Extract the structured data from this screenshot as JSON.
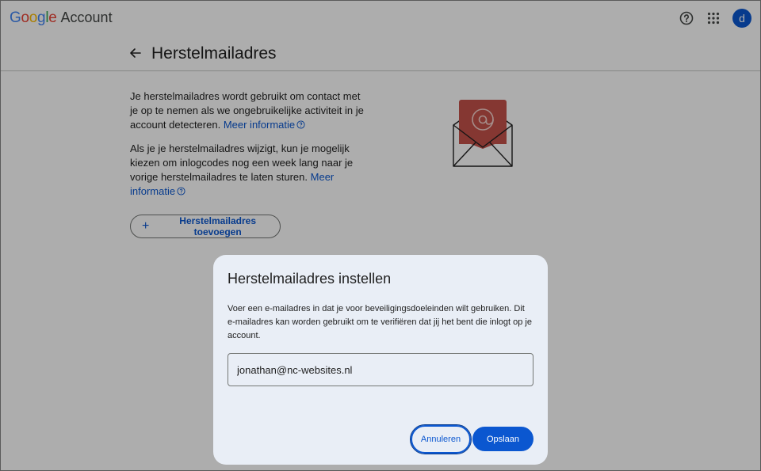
{
  "header": {
    "logo_letters": [
      "G",
      "o",
      "o",
      "g",
      "l",
      "e"
    ],
    "logo_suffix": "Account",
    "avatar_initial": "d",
    "icons": [
      "help-icon",
      "apps-icon"
    ]
  },
  "page": {
    "title": "Herstelmailadres",
    "para1_text": "Je herstelmailadres wordt gebruikt om contact met je op te nemen als we ongebruikelijke activiteit in je account detecteren.",
    "para2_text": "Als je je herstelmailadres wijzigt, kun je mogelijk kiezen om inlogcodes nog een week lang naar je vorige herstelmailadres te laten sturen.",
    "learn_more": "Meer informatie",
    "add_button": "Herstelmailadres toevoegen"
  },
  "dialog": {
    "title": "Herstelmailadres instellen",
    "description": "Voer een e-mailadres in dat je voor beveiligingsdoeleinden wilt gebruiken. Dit e-mailadres kan worden gebruikt om te verifiëren dat jij het bent die inlogt op je account.",
    "email_value": "jonathan@nc-websites.nl",
    "cancel_label": "Annuleren",
    "save_label": "Opslaan"
  },
  "colors": {
    "accent": "#0b57d0",
    "dialog_bg": "#e9eef6",
    "envelope_flap": "#c5524a"
  }
}
